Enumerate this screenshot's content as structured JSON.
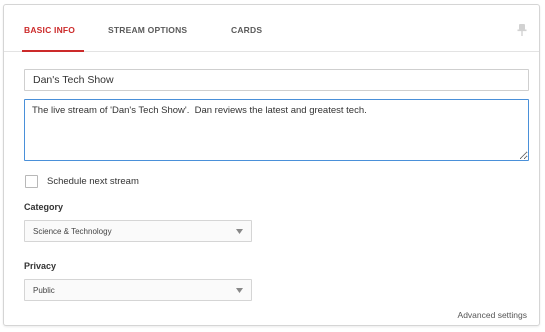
{
  "tabs": [
    {
      "label": "BASIC INFO",
      "active": true
    },
    {
      "label": "STREAM OPTIONS",
      "active": false
    },
    {
      "label": "CARDS",
      "active": false
    }
  ],
  "colors": {
    "accent": "#cc2a2a",
    "focus_border": "#4a90d9"
  },
  "corner_icon": "pin-icon",
  "form": {
    "title_value": "Dan's Tech Show",
    "description_value": "The live stream of 'Dan's Tech Show'.  Dan reviews the latest and greatest tech.",
    "schedule_label": "Schedule next stream",
    "schedule_checked": false,
    "category": {
      "label": "Category",
      "selected": "Science & Technology"
    },
    "privacy": {
      "label": "Privacy",
      "selected": "Public"
    },
    "advanced_link": "Advanced settings"
  }
}
